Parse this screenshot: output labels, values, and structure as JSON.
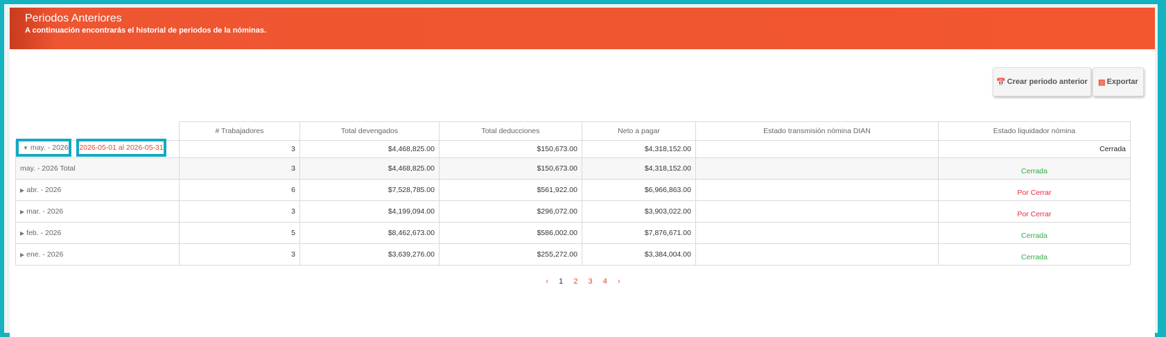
{
  "header": {
    "title": "Periodos Anteriores",
    "subtitle": "A continuación encontrarás el historial de periodos de la nóminas."
  },
  "toolbar": {
    "crear_label": "Crear periodo anterior",
    "exportar_label": "Exportar"
  },
  "table": {
    "headers": [
      "# Trabajadores",
      "Total devengados",
      "Total deducciones",
      "Neto a pagar",
      "Estado transmisión nómina DIAN",
      "Estado liquidador nómina"
    ],
    "expanded": {
      "month": "may. - 2026",
      "range": "2026-05-01 al 2026-05-31",
      "trabajadores": "3",
      "devengados": "$4,468,825.00",
      "deducciones": "$150,673.00",
      "neto": "$4,318,152.00",
      "dian": "",
      "estado": "Cerrada"
    },
    "total": {
      "label": "may. - 2026 Total",
      "trabajadores": "3",
      "devengados": "$4,468,825.00",
      "deducciones": "$150,673.00",
      "neto": "$4,318,152.00",
      "dian": "",
      "estado": "Cerrada"
    },
    "rows": [
      {
        "month": "abr. - 2026",
        "trabajadores": "6",
        "devengados": "$7,528,785.00",
        "deducciones": "$561,922.00",
        "neto": "$6,966,863.00",
        "dian": "",
        "estado": "Por Cerrar"
      },
      {
        "month": "mar. - 2026",
        "trabajadores": "3",
        "devengados": "$4,199,094.00",
        "deducciones": "$296,072.00",
        "neto": "$3,903,022.00",
        "dian": "",
        "estado": "Por Cerrar"
      },
      {
        "month": "feb. - 2026",
        "trabajadores": "5",
        "devengados": "$8,462,673.00",
        "deducciones": "$586,002.00",
        "neto": "$7,876,671.00",
        "dian": "",
        "estado": "Cerrada"
      },
      {
        "month": "ene. - 2026",
        "trabajadores": "3",
        "devengados": "$3,639,276.00",
        "deducciones": "$255,272.00",
        "neto": "$3,384,004.00",
        "dian": "",
        "estado": "Cerrada"
      }
    ]
  },
  "pagination": {
    "prev": "‹",
    "pages": [
      "1",
      "2",
      "3",
      "4"
    ],
    "next": "›",
    "current": "1"
  },
  "colors": {
    "header_bg": "#f2572f",
    "accent": "#e8452a",
    "cerrada": "#35a845",
    "por_cerrar": "#e8283a",
    "highlight_border": "#14a9c0"
  },
  "icons": {
    "crear": "calendar-icon",
    "exportar": "document-icon",
    "expand": "caret-down-icon",
    "collapse": "caret-right-icon"
  }
}
